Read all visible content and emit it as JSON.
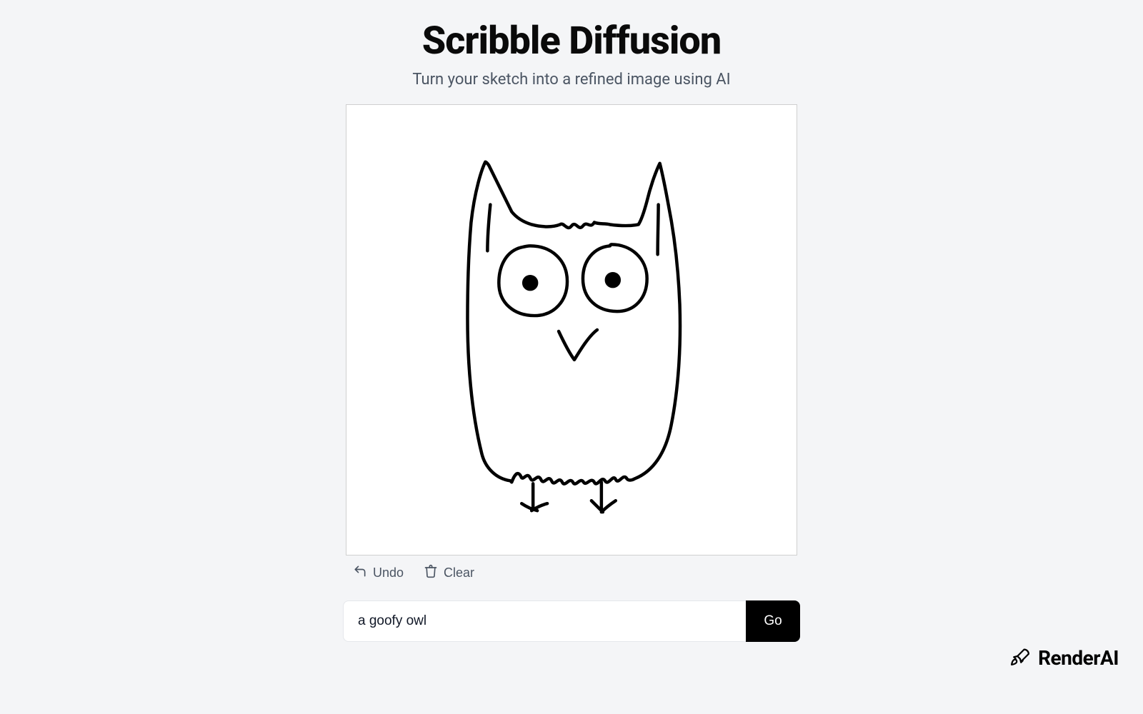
{
  "header": {
    "title": "Scribble Diffusion",
    "subtitle": "Turn your sketch into a refined image using AI"
  },
  "toolbar": {
    "undo_label": "Undo",
    "clear_label": "Clear"
  },
  "prompt": {
    "value": "a goofy owl",
    "placeholder": ""
  },
  "actions": {
    "go_label": "Go"
  },
  "brand": {
    "name": "RenderAI"
  },
  "sketch": {
    "description": "hand-drawn owl sketch"
  }
}
